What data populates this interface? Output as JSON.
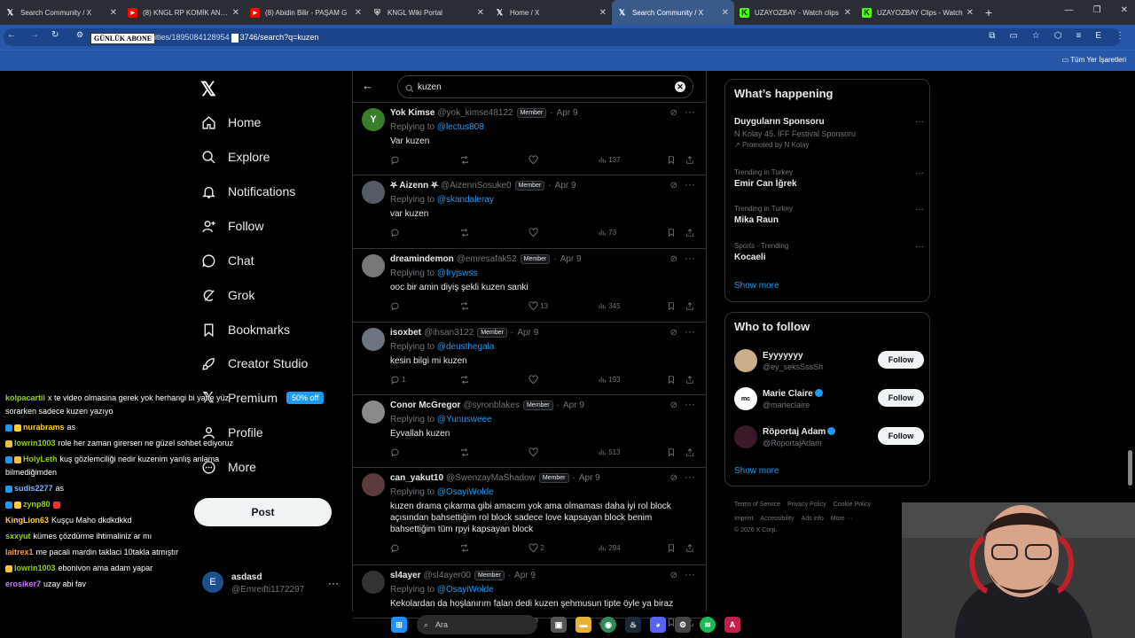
{
  "browser": {
    "tabs": [
      {
        "title": "Search Community / X",
        "icon": "x-icon",
        "color": "#000000"
      },
      {
        "title": "(8) KNGL RP KOMİK ANLA",
        "icon": "youtube-icon",
        "color": "#ff0000"
      },
      {
        "title": "(8) Abidin Bilir - PAŞAM G",
        "icon": "youtube-icon",
        "color": "#ff0000"
      },
      {
        "title": "KNGL Wiki Portal",
        "icon": "shield-icon",
        "color": "#bbbbbb"
      },
      {
        "title": "Home / X",
        "icon": "x-icon",
        "color": "#000000"
      },
      {
        "title": "Search Community / X",
        "icon": "x-icon",
        "color": "#000000",
        "active": true
      },
      {
        "title": "UZAYOZBAY - Watch clips",
        "icon": "kick-icon",
        "color": "#53fc18"
      },
      {
        "title": "UZAYOZBAY Clips - Watch",
        "icon": "kick-icon",
        "color": "#53fc18"
      }
    ],
    "overlay_label": "GÜNLÜK ABONE",
    "url": "nities/1895084128954",
    "url_tail": "3746/search?q=kuzen",
    "bookmarks_label": "Tüm Yer İşaretleri"
  },
  "nav": {
    "items": [
      {
        "label": "Home",
        "icon": "home-icon"
      },
      {
        "label": "Explore",
        "icon": "search-icon"
      },
      {
        "label": "Notifications",
        "icon": "bell-icon"
      },
      {
        "label": "Follow",
        "icon": "add-person-icon"
      },
      {
        "label": "Chat",
        "icon": "chat-icon"
      },
      {
        "label": "Grok",
        "icon": "grok-icon"
      },
      {
        "label": "Bookmarks",
        "icon": "bookmark-icon"
      },
      {
        "label": "Creator Studio",
        "icon": "rocket-icon"
      },
      {
        "label": "Premium",
        "icon": "x-icon"
      },
      {
        "label": "Profile",
        "icon": "person-icon"
      },
      {
        "label": "More",
        "icon": "more-circle-icon"
      }
    ],
    "promo": "50% off",
    "post_label": "Post",
    "account": {
      "initial": "E",
      "name": "asdasd",
      "handle": "@Emreifti1172297"
    }
  },
  "chat": [
    {
      "user": "kolpacartii",
      "text": "x te video olmasina gerek yok herhangi bi yatte yüz",
      "color": "#8fd400"
    },
    {
      "user": "",
      "text": "sorarken sadece kuzen yazıyo",
      "color": "#ffffff"
    },
    {
      "user": "nurabrams",
      "text": "as",
      "color": "#ffcc33"
    },
    {
      "user": "lowrin1003",
      "text": "role her zaman girersen ne güzel sohbet ediyoruz",
      "color": "#8fd400"
    },
    {
      "user": "HolyLeth",
      "text": "kuş gözlemciliği nedir kuzenim yanlış anlama",
      "color": "#8fd400"
    },
    {
      "user": "",
      "text": "bilmediğimden",
      "color": "#ffffff"
    },
    {
      "user": "sudis2277",
      "text": "as",
      "color": "#7ab8ff"
    },
    {
      "user": "zynp80",
      "text": "",
      "color": "#8fd400"
    },
    {
      "user": "KingLion63",
      "text": "Kuşçu Maho dkdkdkkd",
      "color": "#ffcc33"
    },
    {
      "user": "sxxyut",
      "text": "kümes çözdürme ihtimaliniz ar mı",
      "color": "#8fd400"
    },
    {
      "user": "laitrex1",
      "text": "me pacali mardin taklaci 10takla atmıştır",
      "color": "#ff9933"
    },
    {
      "user": "lowrin1003",
      "text": "ebonivon ama adam yapar",
      "color": "#8fd400"
    },
    {
      "user": "erosiker7",
      "text": "uzay abi fav",
      "color": "#cc77ff"
    }
  ],
  "search": {
    "query": "kuzen"
  },
  "tweets": [
    {
      "name": "Yok Kimse",
      "handle": "@yok_kimse48122",
      "badge": "Member",
      "date": "Apr 9",
      "reply_label": "Replying to",
      "reply_to": "@lectus808",
      "text": "Var kuzen",
      "replies": "",
      "likes": "",
      "views": "137",
      "avatar_letter": "Y",
      "avatar_color": "#3a7d2a"
    },
    {
      "name": "⛧ Aizenn ⛧",
      "handle": "@AizennSosuke0",
      "badge": "Member",
      "date": "Apr 9",
      "reply_label": "Replying to",
      "reply_to": "@skandaleray",
      "text": "var kuzen",
      "replies": "",
      "likes": "",
      "views": "73",
      "avatar_letter": "",
      "avatar_color": "#555a66"
    },
    {
      "name": "dreamindemon",
      "handle": "@emresafak52",
      "badge": "Member",
      "date": "Apr 9",
      "reply_label": "Replying to",
      "reply_to": "@fryjswss",
      "text": "ooc bir amin diyiş şekli kuzen sanki",
      "replies": "",
      "likes": "13",
      "views": "345",
      "avatar_letter": "",
      "avatar_color": "#777777"
    },
    {
      "name": "isoxbet",
      "handle": "@ihsan3122",
      "badge": "Member",
      "date": "Apr 9",
      "reply_label": "Replying to",
      "reply_to": "@deusthegala",
      "text": "kesin bilgi mi kuzen",
      "replies": "1",
      "likes": "",
      "views": "193",
      "avatar_letter": "",
      "avatar_color": "#6b7480"
    },
    {
      "name": "Conor McGregor",
      "handle": "@syronblakes",
      "badge": "Member",
      "date": "Apr 9",
      "reply_label": "Replying to",
      "reply_to": "@Yunusweee",
      "text": "Eyvallah kuzen",
      "replies": "",
      "likes": "",
      "views": "513",
      "avatar_letter": "",
      "avatar_color": "#8a8a8a"
    },
    {
      "name": "can_yakut10",
      "handle": "@SwenzayMaShadow",
      "badge": "Member",
      "date": "Apr 9",
      "reply_label": "Replying to",
      "reply_to": "@OsayiWolde",
      "text": "kuzen drama çıkarma gibi amacım yok ama olmaması daha iyi rol block açısından bahsettiğim rol block sadece love kapsayan block benim bahsettiğim tüm rpyi kapsayan block",
      "replies": "",
      "likes": "2",
      "views": "294",
      "avatar_letter": "",
      "avatar_color": "#5a3a3a"
    },
    {
      "name": "sl4ayer",
      "handle": "@sl4ayer00",
      "badge": "Member",
      "date": "Apr 9",
      "reply_label": "Replying to",
      "reply_to": "@OsayiWolde",
      "text": "Kekolardan da hoşlanırım falan dedi kuzen şehmusun tipte öyle ya biraz",
      "replies": "",
      "likes": "",
      "views": "",
      "avatar_letter": "",
      "avatar_color": "#333333"
    }
  ],
  "whats_happening": {
    "title": "What’s happening",
    "trends": [
      {
        "context": "",
        "name": "Duyguların Sponsoru",
        "sub": "N Kolay 45. İFF Festival Sponsoru",
        "promo": "Promoted by N Kolay"
      },
      {
        "context": "Trending in Turkey",
        "name": "Emir Can İğrek"
      },
      {
        "context": "Trending in Turkey",
        "name": "Mika Raun"
      },
      {
        "context": "Sports · Trending",
        "name": "Kocaeli"
      }
    ],
    "show_more": "Show more"
  },
  "who_to_follow": {
    "title": "Who to follow",
    "accounts": [
      {
        "name": "Eyyyyyyy",
        "handle": "@ey_seksSssSh",
        "verified": false,
        "follow": "Follow"
      },
      {
        "name": "Marie Claire",
        "handle": "@marieclaire",
        "verified": true,
        "follow": "Follow"
      },
      {
        "name": "Röportaj Adam",
        "handle": "@RoportajAdam",
        "verified": true,
        "follow": "Follow"
      }
    ],
    "show_more": "Show more"
  },
  "footer": {
    "links": [
      "Terms of Service",
      "Privacy Policy",
      "Cookie Policy",
      "Imprint",
      "Accessibility",
      "Ads info",
      "More ···"
    ],
    "copyright": "© 2026 X Corp."
  },
  "taskbar": {
    "search_placeholder": "Ara"
  }
}
